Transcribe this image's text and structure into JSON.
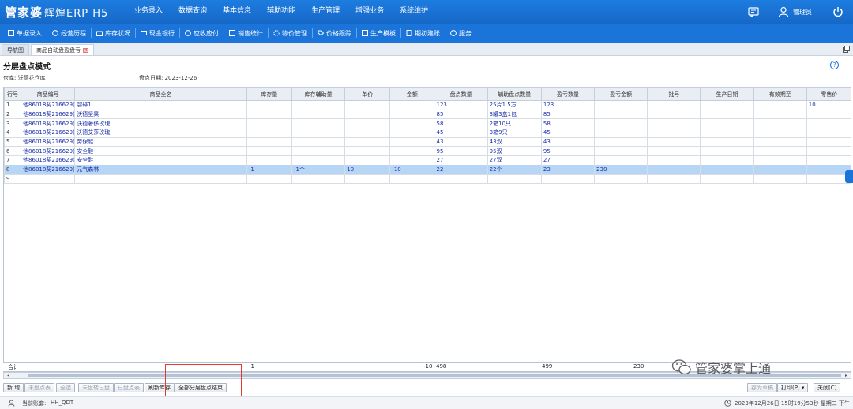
{
  "app": {
    "logo_main": "管家婆",
    "logo_sub": "辉煌ERP H5"
  },
  "mainmenu": [
    "业务录入",
    "数据查询",
    "基本信息",
    "辅助功能",
    "生产管理",
    "增强业务",
    "系统维护"
  ],
  "topright": {
    "user_label": "管理员"
  },
  "toolbar": [
    "单据录入",
    "经营历程",
    "库存状况",
    "现金银行",
    "应收应付",
    "销售统计",
    "物价管理",
    "价格跟踪",
    "生产模板",
    "期初建账",
    "服务"
  ],
  "tabs": [
    "导航图",
    "商品自动盘盈盘亏"
  ],
  "page": {
    "title": "分层盘点模式",
    "warehouse_label": "仓库:",
    "warehouse_value": "沃德花仓库",
    "date_label": "盘点日期:",
    "date_value": "2023-12-26"
  },
  "table": {
    "headers": [
      "行号",
      "商品编号",
      "商品全名",
      "库存量",
      "库存辅助量",
      "单价",
      "金额",
      "盘点数量",
      "辅助盘点数量",
      "盈亏数量",
      "盈亏金额",
      "批号",
      "生产日期",
      "有效期至",
      "零售价"
    ],
    "rows": [
      [
        "1",
        "他86018契216629(",
        "碧碎1",
        "",
        "",
        "",
        "",
        "123",
        "25片1.5方",
        "123",
        "",
        "",
        "",
        "",
        "10"
      ],
      [
        "2",
        "他86018契216629(",
        "沃德坚果",
        "",
        "",
        "",
        "",
        "85",
        "3罐3盒1包",
        "85",
        "",
        "",
        "",
        "",
        ""
      ],
      [
        "3",
        "他86018契216629(",
        "沃德奢侈玫瑰",
        "",
        "",
        "",
        "",
        "58",
        "2箱10只",
        "58",
        "",
        "",
        "",
        "",
        ""
      ],
      [
        "4",
        "他86018契216629(",
        "沃德艾莎玫瑰",
        "",
        "",
        "",
        "",
        "45",
        "3箱9只",
        "45",
        "",
        "",
        "",
        "",
        ""
      ],
      [
        "5",
        "他86018契216629(",
        "劳保鞋",
        "",
        "",
        "",
        "",
        "43",
        "43双",
        "43",
        "",
        "",
        "",
        "",
        ""
      ],
      [
        "6",
        "他86018契216629(",
        "安全鞋",
        "",
        "",
        "",
        "",
        "95",
        "95双",
        "95",
        "",
        "",
        "",
        "",
        ""
      ],
      [
        "7",
        "他86018契216629(",
        "安全鞋",
        "",
        "",
        "",
        "",
        "27",
        "27双",
        "27",
        "",
        "",
        "",
        "",
        ""
      ],
      [
        "8",
        "他86018契216629(",
        "元气森林",
        "-1",
        "-1个",
        "10",
        "-10",
        "22",
        "22个",
        "23",
        "230",
        "",
        "",
        "",
        ""
      ],
      [
        "9",
        "",
        "",
        "",
        "",
        "",
        "",
        "",
        "",
        "",
        "",
        "",
        "",
        "",
        ""
      ]
    ],
    "selected_row": 7
  },
  "summary": {
    "label": "合计",
    "stock_qty": "-1",
    "amount": "-10",
    "count_qty": "498",
    "profit_qty": "499",
    "profit_amount": "230"
  },
  "buttons": {
    "new": "新 增",
    "uncounted_rows": "未盘点表",
    "select_all": "全选",
    "uncounted_zero": "未盘转已盘",
    "counted_rows": "已盘点表",
    "refresh_stock": "刷新库存",
    "all_layer_finish": "全部分层盘点结束",
    "save_draft": "存为草稿",
    "print": "打印(P) ▾",
    "close": "关闭(C)"
  },
  "status": {
    "account_label": "当前账套:",
    "account_value": "HH_QDT",
    "datetime": "2023年12月26日 15时19分53秒 星期二 下午"
  },
  "watermark": "管家婆掌上通"
}
